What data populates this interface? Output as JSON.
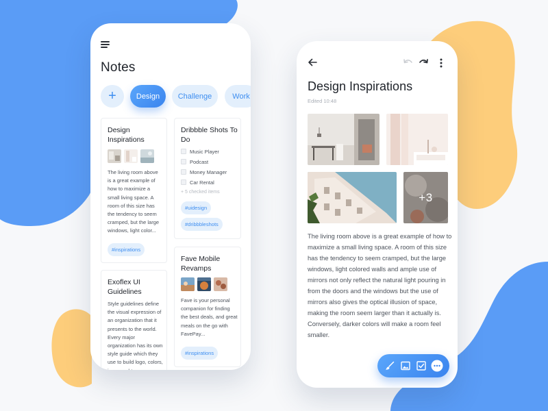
{
  "colors": {
    "accent": "#3e8ef0",
    "accent_light": "#e3effc",
    "blob_blue": "#5a9cf6",
    "blob_yellow": "#fdcd7b"
  },
  "notes_screen": {
    "menu_icon": "hamburger-icon",
    "title": "Notes",
    "chips": {
      "add": "+",
      "items": [
        "Design",
        "Challenge",
        "Work"
      ],
      "active": "Design"
    },
    "cards": [
      {
        "title": "Design Inspirations",
        "thumbnails": 3,
        "text": "The living room above is a great example of how to maximize a small living space. A room of this size has the tendency to seem cramped, but the large windows, light color...",
        "tags": [
          "#inspirations"
        ]
      },
      {
        "title": "Exoflex UI Guidelines",
        "text": "Style guidelines define the visual expression of an organization that it presents to the world. Every major organization has its own style guide which they use to build logo, colors, icons and ty..."
      },
      {
        "title": "Dribbble Shots To Do",
        "checklist": [
          "Music Player",
          "Podcast",
          "Money Manager",
          "Car Rental"
        ],
        "checked_summary": "+ 5 checked items",
        "tags": [
          "#uidesign",
          "#dribbbleshots"
        ]
      },
      {
        "title": "Fave Mobile Revamps",
        "thumbnails": 3,
        "text": "Fave is your personal companion for finding the best deals, and great meals on the go with FavePay...",
        "tags": [
          "#inspirations"
        ]
      }
    ]
  },
  "detail_screen": {
    "back_icon": "arrow-left-icon",
    "undo_icon": "undo-icon",
    "redo_icon": "redo-icon",
    "more_icon": "more-vertical-icon",
    "title": "Design Inspirations",
    "edited": "Edited 10:48",
    "more_photos_label": "+3",
    "body": "The living room above is a great example of how to maximize a small living space. A room of this size has the tendency to seem cramped, but the large windows, light colored walls and ample use of mirrors not only reflect the natural light pouring in from the doors and the windows but the use of mirrors also gives the optical illusion of space, making the room seem larger than it actually is. Conversely, darker colors will make a room feel smaller.",
    "toolbar": [
      "brush-icon",
      "image-icon",
      "checkbox-icon",
      "more-horizontal-icon"
    ]
  }
}
